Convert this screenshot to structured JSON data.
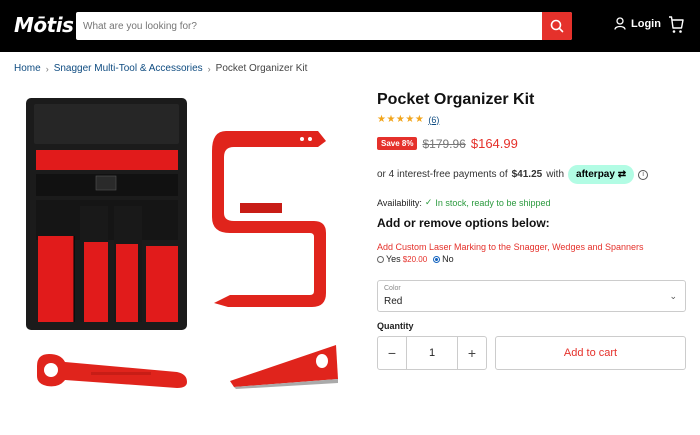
{
  "header": {
    "logo": "Mōtis",
    "search_placeholder": "What are you looking for?",
    "login_label": "Login",
    "cart_icon": "cart-icon"
  },
  "breadcrumb": {
    "items": [
      "Home",
      "Snagger Multi-Tool & Accessories",
      "Pocket Organizer Kit"
    ]
  },
  "product": {
    "title": "Pocket Organizer Kit",
    "stars": "★★★★★",
    "review_count": "(6)",
    "save_badge": "Save 8%",
    "price_old": "$179.96",
    "price_new": "$164.99",
    "afterpay_text_pre": "or 4 interest-free payments of",
    "afterpay_amount": "$41.25",
    "afterpay_text_post": "with",
    "afterpay_brand": "afterpay",
    "availability_label": "Availability:",
    "availability_status": "In stock, ready to be shipped",
    "options_heading": "Add or remove options below:",
    "laser_label": "Add Custom Laser Marking to the Snagger, Wedges and Spanners",
    "radio_yes": "Yes",
    "radio_yes_price": "$20.00",
    "radio_no": "No",
    "color_label": "Color",
    "color_value": "Red",
    "quantity_label": "Quantity",
    "quantity_value": "1",
    "add_to_cart": "Add to cart"
  },
  "colors": {
    "accent_red": "#e5312b",
    "afterpay_mint": "#b2fce4",
    "link_blue": "#0f4c81",
    "in_stock_green": "#2b9a3e"
  }
}
